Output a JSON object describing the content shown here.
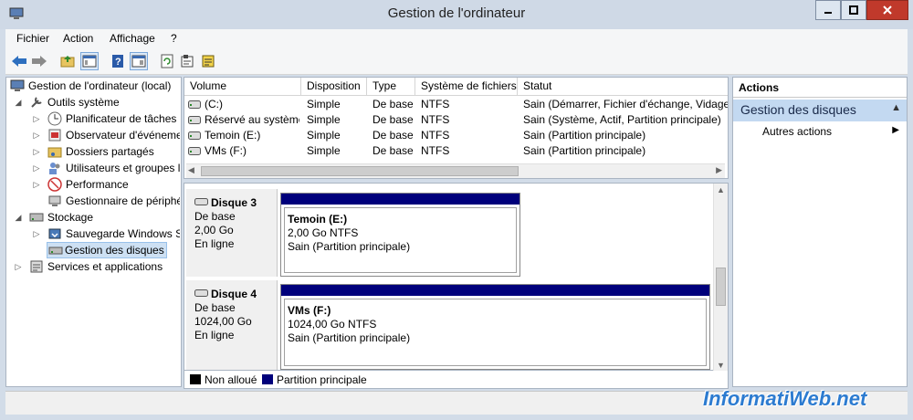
{
  "window": {
    "title": "Gestion de l'ordinateur"
  },
  "menu": [
    "Fichier",
    "Action",
    "Affichage",
    "?"
  ],
  "tree": {
    "root": "Gestion de l'ordinateur (local)",
    "outils": "Outils système",
    "planificateur": "Planificateur de tâches",
    "observateur": "Observateur d'événements",
    "dossiers": "Dossiers partagés",
    "utilisateurs": "Utilisateurs et groupes l",
    "performance": "Performance",
    "gestionnaire": "Gestionnaire de périphériques",
    "stockage": "Stockage",
    "sauvegarde": "Sauvegarde Windows Se",
    "gestion_disques": "Gestion des disques",
    "services": "Services et applications"
  },
  "volumes": {
    "headers": [
      "Volume",
      "Disposition",
      "Type",
      "Système de fichiers",
      "Statut"
    ],
    "rows": [
      {
        "volume": "(C:)",
        "disposition": "Simple",
        "type": "De base",
        "fs": "NTFS",
        "statut": "Sain (Démarrer, Fichier d'échange, Vidage s"
      },
      {
        "volume": "Réservé au système",
        "disposition": "Simple",
        "type": "De base",
        "fs": "NTFS",
        "statut": "Sain (Système, Actif, Partition principale)"
      },
      {
        "volume": "Temoin (E:)",
        "disposition": "Simple",
        "type": "De base",
        "fs": "NTFS",
        "statut": "Sain (Partition principale)"
      },
      {
        "volume": "VMs (F:)",
        "disposition": "Simple",
        "type": "De base",
        "fs": "NTFS",
        "statut": "Sain (Partition principale)"
      }
    ]
  },
  "disks": [
    {
      "name": "Disque 3",
      "type": "De base",
      "size": "2,00 Go",
      "status": "En ligne",
      "partition": {
        "label": "Temoin  (E:)",
        "size": "2,00 Go NTFS",
        "status": "Sain (Partition principale)"
      }
    },
    {
      "name": "Disque 4",
      "type": "De base",
      "size": "1024,00 Go",
      "status": "En ligne",
      "partition": {
        "label": "VMs  (F:)",
        "size": "1024,00 Go NTFS",
        "status": "Sain (Partition principale)"
      }
    }
  ],
  "legend": {
    "unallocated": "Non alloué",
    "primary": "Partition principale",
    "unallocated_color": "#000000",
    "primary_color": "#00007b"
  },
  "actions": {
    "header": "Actions",
    "section": "Gestion des disques",
    "item": "Autres actions"
  },
  "watermark": "InformatiWeb.net",
  "colors": {
    "accent": "#00007b",
    "selected": "#cde0f3",
    "close": "#c0392b"
  }
}
